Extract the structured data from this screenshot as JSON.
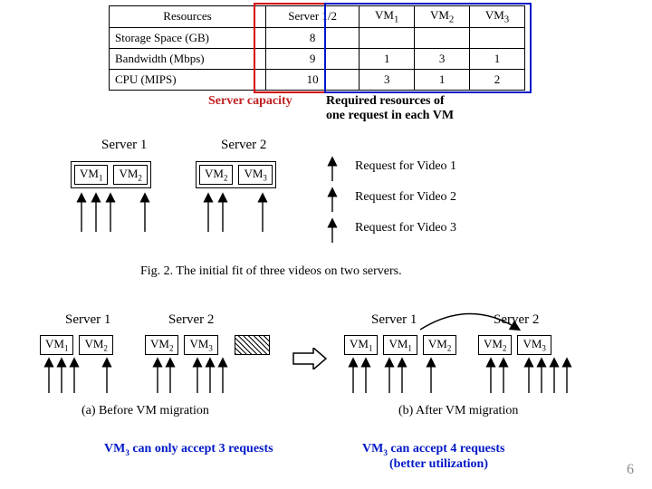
{
  "table": {
    "headers": [
      "Resources",
      "Server 1/2",
      "VM1",
      "VM2",
      "VM3"
    ],
    "rows": [
      [
        "Storage Space (GB)",
        "8",
        "",
        "",
        ""
      ],
      [
        "Bandwidth (Mbps)",
        "9",
        "1",
        "3",
        "1"
      ],
      [
        "CPU (MIPS)",
        "10",
        "3",
        "1",
        "2"
      ]
    ]
  },
  "labels": {
    "server_capacity": "Server capacity",
    "required_line1": "Required resources of",
    "required_line2": "one request in each VM"
  },
  "fig2": {
    "server1": "Server 1",
    "server2": "Server 2",
    "vm1": "VM1",
    "vm2": "VM2",
    "vm3": "VM3",
    "req1": "Request for Video 1",
    "req2": "Request for Video 2",
    "req3": "Request for Video 3",
    "caption": "Fig. 2.    The initial fit of three videos on two servers."
  },
  "panels": {
    "a": "(a) Before VM migration",
    "b": "(b) After VM migration",
    "note_a1": "VM3 can only accept 3 requests",
    "note_b1": "VM3 can accept 4 requests",
    "note_b2": "(better utilization)"
  },
  "page": "6"
}
